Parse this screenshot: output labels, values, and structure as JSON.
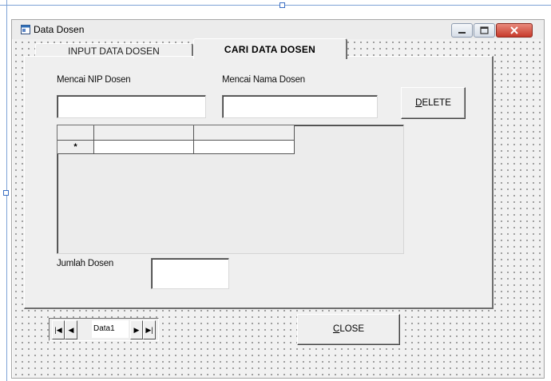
{
  "window": {
    "title": "Data Dosen"
  },
  "tabs": {
    "inactive_label": "INPUT DATA DOSEN",
    "active_label": "CARI DATA DOSEN"
  },
  "search": {
    "nip_label": "Mencai NIP Dosen",
    "nip_value": "",
    "name_label": "Mencai Nama Dosen",
    "name_value": ""
  },
  "buttons": {
    "delete_first": "D",
    "delete_rest": "ELETE",
    "close_first": "C",
    "close_rest": "LOSE"
  },
  "grid": {
    "new_row_marker": "*"
  },
  "count": {
    "label": "Jumlah Dosen",
    "value": ""
  },
  "navigator": {
    "caption": "Data1",
    "first_glyph": "|◀",
    "prev_glyph": "◀",
    "next_glyph": "▶",
    "last_glyph": "▶|"
  },
  "colors": {
    "close_button": "#c6392a",
    "designer_selection": "#7da2d6"
  }
}
